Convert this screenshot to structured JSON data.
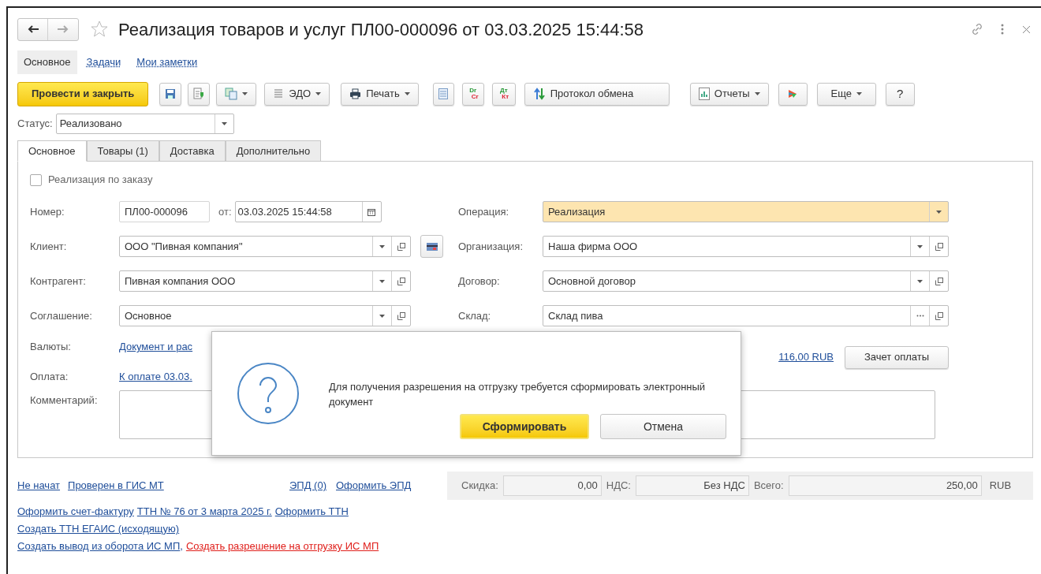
{
  "window": {
    "title": "Реализация товаров и услуг ПЛ00-000096 от 03.03.2025 15:44:58"
  },
  "nav_tabs": [
    {
      "label": "Основное",
      "selected": true
    },
    {
      "label": "Задачи",
      "selected": false
    },
    {
      "label": "Мои заметки",
      "selected": false
    }
  ],
  "toolbar": {
    "post_close": "Провести и закрыть",
    "edo": "ЭДО",
    "print": "Печать",
    "dr": "Dr",
    "cr": "Cr",
    "dt": "Дт",
    "kt": "Кт",
    "exchange_log": "Протокол обмена",
    "reports": "Отчеты",
    "more": "Еще",
    "help": "?"
  },
  "status": {
    "label": "Статус:",
    "value": "Реализовано"
  },
  "form_tabs": [
    {
      "label": "Основное",
      "selected": true
    },
    {
      "label": "Товары (1)",
      "selected": false
    },
    {
      "label": "Доставка",
      "selected": false
    },
    {
      "label": "Дополнительно",
      "selected": false
    }
  ],
  "order_checkbox": {
    "label": "Реализация по заказу",
    "checked": false
  },
  "number": {
    "label": "Номер:",
    "value": "ПЛ00-000096",
    "date_label": "от:",
    "date": "03.03.2025 15:44:58"
  },
  "left_fields": [
    {
      "label": "Клиент:",
      "value": "ООО \"Пивная компания\"",
      "buttons": [
        {
          "kind": "dropdown"
        },
        {
          "kind": "open"
        }
      ],
      "card_button": true
    },
    {
      "label": "Контрагент:",
      "value": "Пивная компания ООО",
      "buttons": [
        {
          "kind": "dropdown"
        },
        {
          "kind": "open"
        }
      ],
      "card_button": false
    },
    {
      "label": "Соглашение:",
      "value": "Основное",
      "buttons": [
        {
          "kind": "dropdown"
        },
        {
          "kind": "open"
        }
      ],
      "card_button": false
    }
  ],
  "right_fields": [
    {
      "label": "Операция:",
      "value": "Реализация",
      "buttons": [
        {
          "kind": "dropdown"
        }
      ],
      "highlighted": true
    },
    {
      "label": "Организация:",
      "value": "Наша фирма ООО",
      "buttons": [
        {
          "kind": "dropdown"
        },
        {
          "kind": "open"
        }
      ],
      "highlighted": false
    },
    {
      "label": "Договор:",
      "value": "Основной договор",
      "buttons": [
        {
          "kind": "dropdown"
        },
        {
          "kind": "open"
        }
      ],
      "highlighted": false
    },
    {
      "label": "Склад:",
      "value": "Склад пива",
      "buttons": [
        {
          "kind": "choose"
        },
        {
          "kind": "open"
        }
      ],
      "highlighted": false
    }
  ],
  "currencies": {
    "label": "Валюты:",
    "link": "Документ и рас"
  },
  "payment": {
    "label": "Оплата:",
    "link": "К оплате 03.03.",
    "amount_link": "116,00 RUB",
    "button": "Зачет оплаты"
  },
  "comment": {
    "label": "Комментарий:"
  },
  "footer_links": [
    {
      "text": "Не начат"
    },
    {
      "text": "Проверен в ГИС МТ"
    }
  ],
  "epd_links": [
    {
      "text": "ЭПД (0)"
    },
    {
      "text": "Оформить ЭПД"
    }
  ],
  "totals": [
    {
      "label": "Скидка:",
      "value": "0,00"
    },
    {
      "label": "НДС:",
      "value": "Без НДС"
    },
    {
      "label": "Всего:",
      "value": "250,00"
    }
  ],
  "currency": "RUB",
  "action_lines": [
    [
      {
        "kind": "link",
        "text": "Оформить счет-фактуру",
        "color": "#1f4e9a"
      },
      {
        "kind": "link",
        "text": "ТТН № 76 от 3 марта 2025 г.",
        "color": "#1f4e9a"
      },
      {
        "kind": "link",
        "text": "Оформить ТТН",
        "color": "#1f4e9a"
      }
    ],
    [
      {
        "kind": "link",
        "text": "Создать ТТН ЕГАИС (исходящую)",
        "color": "#1f4e9a"
      }
    ],
    [
      {
        "kind": "link",
        "text": "Создать вывод из оборота ИС МП",
        "color": "#1f4e9a"
      },
      {
        "kind": "separator",
        "text": ","
      },
      {
        "kind": "link",
        "text": "Создать разрешение на отгрузку ИС МП",
        "color": "#e0201c"
      }
    ]
  ],
  "dialog": {
    "message": "Для получения разрешения на отгрузку требуется сформировать электронный документ",
    "buttons": [
      {
        "label": "Сформировать",
        "default": true
      },
      {
        "label": "Отмена",
        "default": false
      }
    ]
  }
}
